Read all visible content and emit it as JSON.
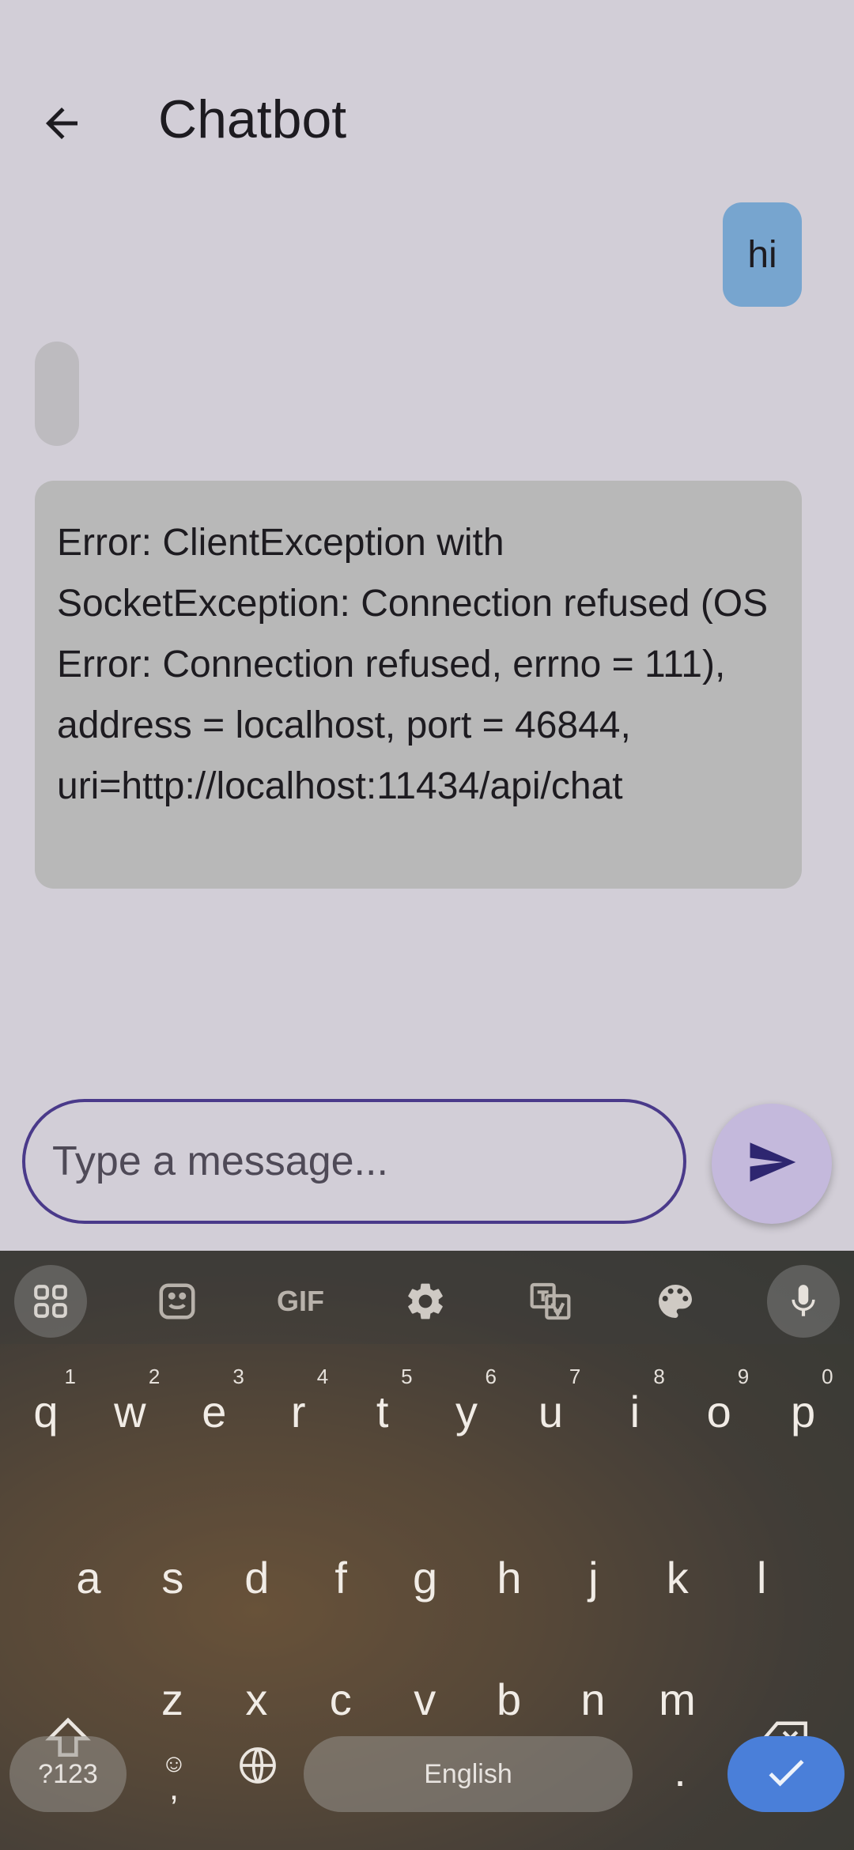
{
  "header": {
    "title": "Chatbot",
    "back_icon": "arrow-left-icon"
  },
  "messages": {
    "user_1": "hi",
    "bot_1": "",
    "bot_2": "Error: ClientException with SocketException: Connection refused (OS Error: Connection refused, errno = 111), address = localhost, port = 46844, uri=http://localhost:11434/api/chat"
  },
  "composer": {
    "placeholder": "Type a message...",
    "send_icon": "send-icon"
  },
  "keyboard": {
    "toolbar": [
      "grid-icon",
      "sticker-icon",
      "gif-icon",
      "gear-icon",
      "translate-icon",
      "palette-icon",
      "mic-icon"
    ],
    "gif_label": "GIF",
    "row1": [
      {
        "k": "q",
        "n": "1"
      },
      {
        "k": "w",
        "n": "2"
      },
      {
        "k": "e",
        "n": "3"
      },
      {
        "k": "r",
        "n": "4"
      },
      {
        "k": "t",
        "n": "5"
      },
      {
        "k": "y",
        "n": "6"
      },
      {
        "k": "u",
        "n": "7"
      },
      {
        "k": "i",
        "n": "8"
      },
      {
        "k": "o",
        "n": "9"
      },
      {
        "k": "p",
        "n": "0"
      }
    ],
    "row2": [
      "a",
      "s",
      "d",
      "f",
      "g",
      "h",
      "j",
      "k",
      "l"
    ],
    "row3": [
      "z",
      "x",
      "c",
      "v",
      "b",
      "n",
      "m"
    ],
    "symbols_label": "?123",
    "emoji_key": "☺",
    "comma_key": ",",
    "space_label": "English",
    "period_key": ".",
    "colors": {
      "enter": "#4a7fd9",
      "accent": "#4a3a8a"
    }
  }
}
